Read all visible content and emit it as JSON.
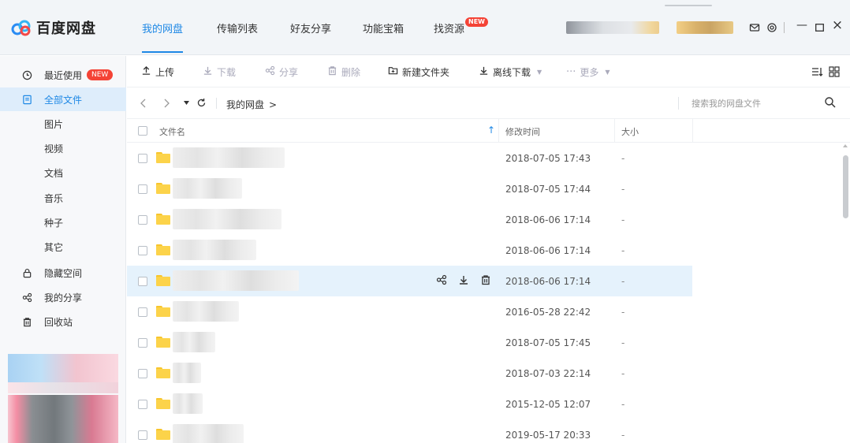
{
  "app": {
    "logo_text": "百度网盘",
    "accent_color": "#1e88e5",
    "badge_color": "#f44336"
  },
  "header": {
    "tabs": [
      {
        "label": "我的网盘",
        "active": true
      },
      {
        "label": "传输列表",
        "active": false
      },
      {
        "label": "好友分享",
        "active": false
      },
      {
        "label": "功能宝箱",
        "active": false
      },
      {
        "label": "找资源",
        "active": false,
        "badge": "NEW"
      }
    ],
    "icons": [
      "mail-icon",
      "settings-icon",
      "minimize-icon",
      "maximize-icon",
      "close-icon"
    ],
    "minimize_label": "—",
    "close_label": "×"
  },
  "sidebar": {
    "items": [
      {
        "label": "最近使用",
        "icon": "clock-icon",
        "badge": "NEW"
      },
      {
        "label": "全部文件",
        "icon": "file-icon",
        "active": true
      },
      {
        "label": "图片"
      },
      {
        "label": "视频"
      },
      {
        "label": "文档"
      },
      {
        "label": "音乐"
      },
      {
        "label": "种子"
      },
      {
        "label": "其它"
      },
      {
        "label": "隐藏空间",
        "icon": "lock-icon"
      },
      {
        "label": "我的分享",
        "icon": "share-icon"
      },
      {
        "label": "回收站",
        "icon": "trash-icon"
      }
    ]
  },
  "toolbar": {
    "upload": "上传",
    "download": "下载",
    "share": "分享",
    "delete": "删除",
    "new_folder": "新建文件夹",
    "offline_download": "离线下载",
    "more": "更多",
    "more_dots": "···"
  },
  "pathbar": {
    "breadcrumb": "我的网盘",
    "breadcrumb_sep": ">",
    "search_placeholder": "搜索我的网盘文件"
  },
  "table": {
    "columns": {
      "name": "文件名",
      "modified": "修改时间",
      "size": "大小"
    },
    "sort_indicator": "↑",
    "rows": [
      {
        "modified": "2018-07-05 17:43",
        "size": "-"
      },
      {
        "modified": "2018-07-05 17:44",
        "size": "-"
      },
      {
        "modified": "2018-06-06 17:14",
        "size": "-"
      },
      {
        "modified": "2018-06-06 17:14",
        "size": "-"
      },
      {
        "modified": "2018-06-06 17:14",
        "size": "-",
        "hover": true
      },
      {
        "modified": "2016-05-28 22:42",
        "size": "-"
      },
      {
        "modified": "2018-07-05 17:45",
        "size": "-"
      },
      {
        "modified": "2018-07-03 22:14",
        "size": "-"
      },
      {
        "modified": "2015-12-05 12:07",
        "size": "-"
      },
      {
        "modified": "2019-05-17 20:33",
        "size": "-"
      }
    ]
  }
}
